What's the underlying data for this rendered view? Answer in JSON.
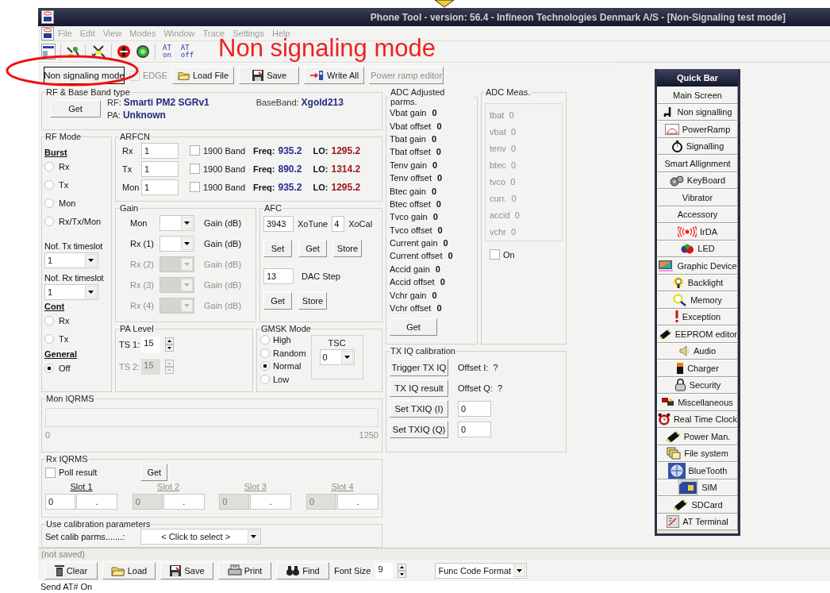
{
  "window": {
    "title": "Phone Tool - version: 56.4 - Infineon Technologies Denmark A/S - [Non-Signaling test mode]"
  },
  "menu": [
    {
      "label": "File",
      "disabled": true
    },
    {
      "label": "Edit",
      "disabled": true
    },
    {
      "label": "View",
      "disabled": true
    },
    {
      "label": "Modes",
      "disabled": true
    },
    {
      "label": "Window",
      "disabled": true
    },
    {
      "label": "Trace",
      "disabled": true
    },
    {
      "label": "Settings",
      "disabled": true
    },
    {
      "label": "Help",
      "disabled": true
    }
  ],
  "at_buttons": [
    {
      "top": "AT",
      "bottom": "on"
    },
    {
      "top": "AT",
      "bottom": "off"
    }
  ],
  "annotation": {
    "text": "Non signaling mode"
  },
  "action_bar": {
    "mode_button": "Non signaling mode",
    "edge": {
      "label": "EDGE",
      "checked": false,
      "disabled": true
    },
    "buttons": [
      {
        "label": "Load File",
        "disabled": false
      },
      {
        "label": "Save",
        "disabled": false
      },
      {
        "label": "Write All",
        "disabled": false
      },
      {
        "label": "Power ramp editor",
        "disabled": true
      }
    ]
  },
  "rf_baseband": {
    "title": "RF & Base Band type",
    "get_button": "Get",
    "rf_label": "RF:",
    "rf_value": "Smarti PM2 SGRv1",
    "baseband_label": "BaseBand:",
    "baseband_value": "Xgold213",
    "pa_label": "PA:",
    "pa_value": "Unknown"
  },
  "rf_mode": {
    "title": "RF Mode",
    "burst_title": "Burst",
    "burst": [
      {
        "label": "Rx",
        "selected": false
      },
      {
        "label": "Tx",
        "selected": false
      },
      {
        "label": "Mon",
        "selected": false
      },
      {
        "label": "Rx/Tx/Mon",
        "selected": false
      }
    ],
    "tx_timeslot_label": "Nof. Tx timeslot",
    "tx_timeslot": "1",
    "rx_timeslot_label": "Nof. Rx timeslot",
    "rx_timeslot": "1",
    "cont_title": "Cont",
    "cont": [
      {
        "label": "Rx",
        "selected": false
      },
      {
        "label": "Tx",
        "selected": false
      }
    ],
    "general_title": "General",
    "general": [
      {
        "label": "Off",
        "selected": true
      }
    ]
  },
  "arfcn": {
    "title": "ARFCN",
    "rows": [
      {
        "label": "Rx",
        "value": "1",
        "band_label": "1900 Band",
        "band_checked": false,
        "freq_label": "Freq:",
        "freq": "935.2",
        "lo_label": "LO:",
        "lo": "1295.2"
      },
      {
        "label": "Tx",
        "value": "1",
        "band_label": "1900 Band",
        "band_checked": false,
        "freq_label": "Freq:",
        "freq": "890.2",
        "lo_label": "LO:",
        "lo": "1314.2"
      },
      {
        "label": "Mon",
        "value": "1",
        "band_label": "1900 Band",
        "band_checked": false,
        "freq_label": "Freq:",
        "freq": "935.2",
        "lo_label": "LO:",
        "lo": "1295.2"
      }
    ]
  },
  "gain": {
    "title": "Gain",
    "rows": [
      {
        "label": "Mon",
        "unit": "Gain (dB)",
        "disabled": false
      },
      {
        "label": "Rx (1)",
        "unit": "Gain (dB)",
        "disabled": false
      },
      {
        "label": "Rx (2)",
        "unit": "Gain (dB)",
        "disabled": true
      },
      {
        "label": "Rx (3)",
        "unit": "Gain (dB)",
        "disabled": true
      },
      {
        "label": "Rx (4)",
        "unit": "Gain (dB)",
        "disabled": true
      }
    ]
  },
  "afc": {
    "title": "AFC",
    "xotune": "3943",
    "xotune_label": "XoTune",
    "xocal": "4",
    "xocal_label": "XoCal",
    "buttons": [
      "Set",
      "Get",
      "Store"
    ],
    "dac_value": "13",
    "dac_label": "DAC Step",
    "dac_buttons": [
      "Get",
      "Store"
    ]
  },
  "pa_level": {
    "title": "PA Level",
    "rows": [
      {
        "label": "TS 1:",
        "value": "15",
        "disabled": false
      },
      {
        "label": "TS 2:",
        "value": "15",
        "disabled": true
      }
    ]
  },
  "gmsk": {
    "title": "GMSK Mode",
    "options": [
      {
        "label": "High",
        "selected": false
      },
      {
        "label": "Random",
        "selected": false
      },
      {
        "label": "Normal",
        "selected": true
      },
      {
        "label": "Low",
        "selected": false
      }
    ],
    "tsc_title": "TSC",
    "tsc_value": "0"
  },
  "adc_adjusted": {
    "title": "ADC Adjusted parms.",
    "rows": [
      {
        "label": "Vbat gain",
        "value": "0"
      },
      {
        "label": "Vbat offset",
        "value": "0"
      },
      {
        "label": "Tbat gain",
        "value": "0"
      },
      {
        "label": "Tbat offset",
        "value": "0"
      },
      {
        "label": "Tenv gain",
        "value": "0"
      },
      {
        "label": "Tenv offset",
        "value": "0"
      },
      {
        "label": "Btec gain",
        "value": "0"
      },
      {
        "label": "Btec offset",
        "value": "0"
      },
      {
        "label": "Tvco gain",
        "value": "0"
      },
      {
        "label": "Tvco offset",
        "value": "0"
      },
      {
        "label": "Current gain",
        "value": "0"
      },
      {
        "label": "Current offset",
        "value": "0"
      },
      {
        "label": "Accid gain",
        "value": "0"
      },
      {
        "label": "Accid offset",
        "value": "0"
      },
      {
        "label": "Vchr gain",
        "value": "0"
      },
      {
        "label": "Vchr offset",
        "value": "0"
      }
    ],
    "get_button": "Get"
  },
  "adc_meas": {
    "title": "ADC Meas.",
    "disabled": true,
    "rows": [
      {
        "label": "tbat",
        "value": "0"
      },
      {
        "label": "vbat",
        "value": "0"
      },
      {
        "label": "tenv",
        "value": "0"
      },
      {
        "label": "btec",
        "value": "0"
      },
      {
        "label": "tvco",
        "value": "0"
      },
      {
        "label": "curr.",
        "value": "0"
      },
      {
        "label": "accid",
        "value": "0"
      },
      {
        "label": "vchr",
        "value": "0"
      }
    ],
    "on": {
      "label": "On",
      "checked": false
    }
  },
  "tx_iq": {
    "title": "TX IQ calibration",
    "trigger_button": "Trigger TX IQ",
    "result_button": "TX IQ result",
    "offset_i_label": "Offset I:",
    "offset_i": "?",
    "offset_q_label": "Offset Q:",
    "offset_q": "?",
    "set_i_button": "Set TXIQ (I)",
    "set_i_value": "0",
    "set_q_button": "Set TXIQ (Q)",
    "set_q_value": "0"
  },
  "mon_iqrms": {
    "title": "Mon IQRMS",
    "level": 0,
    "min_label": "0",
    "max_label": "1250"
  },
  "rx_iqrms": {
    "title": "Rx IQRMS",
    "poll": {
      "label": "Poll result",
      "checked": false
    },
    "get_button": "Get",
    "slots": [
      {
        "label": "Slot 1",
        "value": "0",
        "value_2": ".",
        "disabled": false
      },
      {
        "label": "Slot 2",
        "value": "0",
        "value_2": ".",
        "disabled": true
      },
      {
        "label": "Slot 3",
        "value": "0",
        "value_2": ".",
        "disabled": true
      },
      {
        "label": "Slot 4",
        "value": "0",
        "value_2": ".",
        "disabled": true
      }
    ]
  },
  "calibration": {
    "title": "Use calibration parameters",
    "label": "Set calib parms.......:",
    "value": "< Click to select >"
  },
  "quick_bar": {
    "title": "Quick Bar",
    "items": [
      {
        "label": "Main Screen"
      },
      {
        "label": "Non signalling"
      },
      {
        "label": "PowerRamp"
      },
      {
        "label": "Signalling"
      },
      {
        "label": "Smart Allignment"
      },
      {
        "label": "KeyBoard"
      },
      {
        "label": "Vibrator"
      },
      {
        "label": "Accessory"
      },
      {
        "label": "IrDA"
      },
      {
        "label": "LED"
      },
      {
        "label": "Graphic Device"
      },
      {
        "label": "Backlight"
      },
      {
        "label": "Memory"
      },
      {
        "label": "Exception"
      },
      {
        "label": "EEPROM editor"
      },
      {
        "label": "Audio"
      },
      {
        "label": "Charger"
      },
      {
        "label": "Security"
      },
      {
        "label": "Miscellaneous"
      },
      {
        "label": "Real Time Clock"
      },
      {
        "label": "Power Man."
      },
      {
        "label": "File system"
      },
      {
        "label": "BlueTooth"
      },
      {
        "label": "SIM"
      },
      {
        "label": "SDCard"
      },
      {
        "label": "AT Terminal"
      }
    ]
  },
  "log": {
    "status": "(not saved)",
    "buttons": [
      "Clear",
      "Load",
      "Save",
      "Print",
      "Find"
    ],
    "font_size_label": "Font Size",
    "font_size": "9",
    "format": "Func Code Format",
    "last_line": "Send AT# On"
  }
}
